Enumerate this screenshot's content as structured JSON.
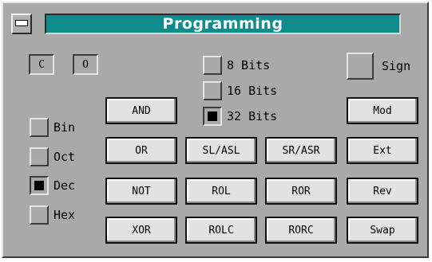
{
  "window": {
    "title": "Programming"
  },
  "flags": {
    "carry": "C",
    "overflow": "O"
  },
  "word_size": {
    "options": [
      {
        "label": "8 Bits",
        "selected": false
      },
      {
        "label": "16 Bits",
        "selected": false
      },
      {
        "label": "32 Bits",
        "selected": true
      }
    ]
  },
  "sign": {
    "label": "Sign",
    "checked": false
  },
  "base": {
    "options": [
      {
        "label": "Bin",
        "selected": false
      },
      {
        "label": "Oct",
        "selected": false
      },
      {
        "label": "Dec",
        "selected": true
      },
      {
        "label": "Hex",
        "selected": false
      }
    ]
  },
  "buttons": {
    "and": "AND",
    "or": "OR",
    "not": "NOT",
    "xor": "XOR",
    "sl_asl": "SL/ASL",
    "rol": "ROL",
    "rolc": "ROLC",
    "sr_asr": "SR/ASR",
    "ror": "ROR",
    "rorc": "RORC",
    "mod": "Mod",
    "ext": "Ext",
    "rev": "Rev",
    "swap": "Swap"
  },
  "icons": {
    "window_menu": "window-menu-icon"
  },
  "colors": {
    "titlebar": "#108c8c",
    "panel": "#a9a9a9",
    "button_face": "#e2e2e2"
  }
}
